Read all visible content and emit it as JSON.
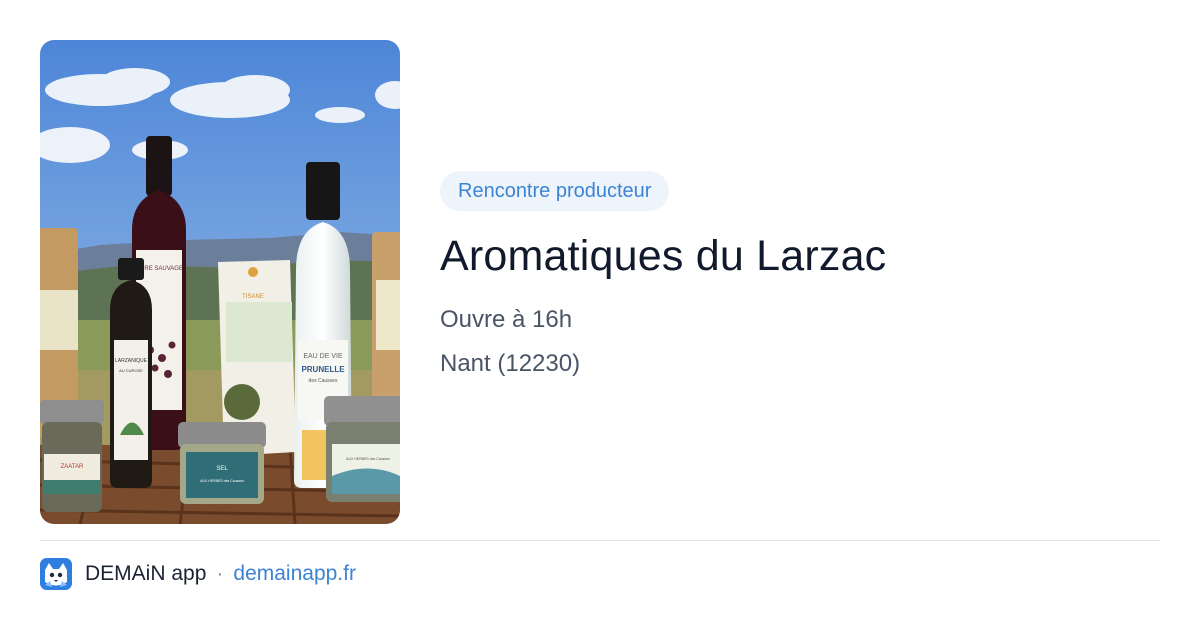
{
  "listing": {
    "badge": "Rencontre producteur",
    "title": "Aromatiques du Larzac",
    "hours": "Ouvre à 16h",
    "location": "Nant (12230)"
  },
  "photo": {
    "labels": {
      "bottle_left": "MÛRE SAUVAGE",
      "vinegar": "LARZANIQUE",
      "vinegar_sub": "AU CUROSE",
      "tea_bag": "TISANE",
      "eau_de_vie_1": "EAU DE VIE",
      "eau_de_vie_2": "PRUNELLE",
      "eau_de_vie_3": "des Causses",
      "jar_left": "ZAATAR",
      "jar_middle": "SEL",
      "jar_middle_sub": "AUX HERBES des Causses",
      "jar_right": "AUX HERBES des Causses"
    }
  },
  "footer": {
    "app_name": "DEMAiN app",
    "separator": "·",
    "domain": "demainapp.fr"
  },
  "colors": {
    "accent": "#3c83d2",
    "badge_bg": "#edf4fc",
    "title": "#101a2c",
    "meta": "#4a5466"
  }
}
